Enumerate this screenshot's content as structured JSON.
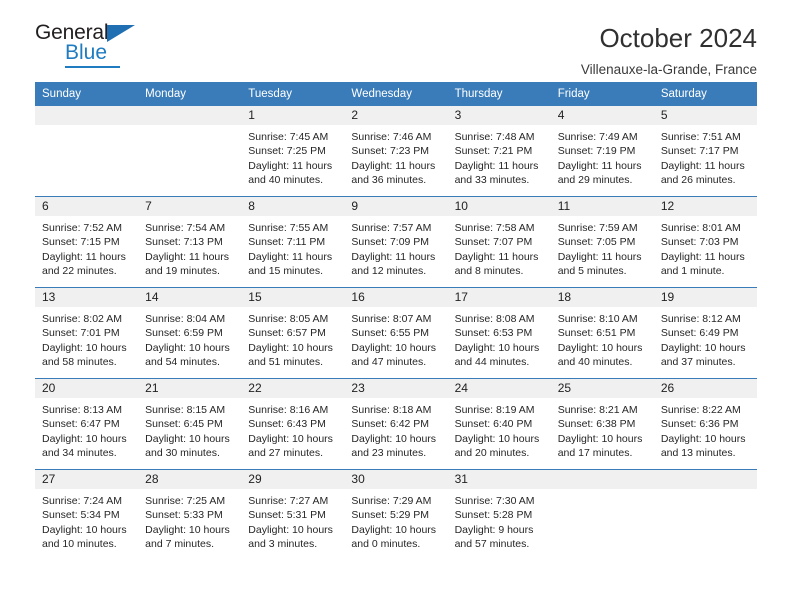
{
  "brand": {
    "name_part1": "General",
    "name_part2": "Blue",
    "triangle_color": "#1f6fb2",
    "blue_color": "#1f7cc1"
  },
  "header": {
    "title": "October 2024",
    "subtitle": "Villenauxe-la-Grande, France"
  },
  "theme": {
    "header_bg": "#3a7cba",
    "daynum_bg": "#f0f0f0",
    "row_divider": "#3a7cba"
  },
  "calendar": {
    "weekday_headers": [
      "Sunday",
      "Monday",
      "Tuesday",
      "Wednesday",
      "Thursday",
      "Friday",
      "Saturday"
    ],
    "labels": {
      "sunrise": "Sunrise:",
      "sunset": "Sunset:",
      "daylight": "Daylight:"
    },
    "weeks": [
      [
        {
          "day": "",
          "empty": true
        },
        {
          "day": "",
          "empty": true
        },
        {
          "day": "1",
          "sunrise": "Sunrise: 7:45 AM",
          "sunset": "Sunset: 7:25 PM",
          "daylight1": "Daylight: 11 hours",
          "daylight2": "and 40 minutes."
        },
        {
          "day": "2",
          "sunrise": "Sunrise: 7:46 AM",
          "sunset": "Sunset: 7:23 PM",
          "daylight1": "Daylight: 11 hours",
          "daylight2": "and 36 minutes."
        },
        {
          "day": "3",
          "sunrise": "Sunrise: 7:48 AM",
          "sunset": "Sunset: 7:21 PM",
          "daylight1": "Daylight: 11 hours",
          "daylight2": "and 33 minutes."
        },
        {
          "day": "4",
          "sunrise": "Sunrise: 7:49 AM",
          "sunset": "Sunset: 7:19 PM",
          "daylight1": "Daylight: 11 hours",
          "daylight2": "and 29 minutes."
        },
        {
          "day": "5",
          "sunrise": "Sunrise: 7:51 AM",
          "sunset": "Sunset: 7:17 PM",
          "daylight1": "Daylight: 11 hours",
          "daylight2": "and 26 minutes."
        }
      ],
      [
        {
          "day": "6",
          "sunrise": "Sunrise: 7:52 AM",
          "sunset": "Sunset: 7:15 PM",
          "daylight1": "Daylight: 11 hours",
          "daylight2": "and 22 minutes."
        },
        {
          "day": "7",
          "sunrise": "Sunrise: 7:54 AM",
          "sunset": "Sunset: 7:13 PM",
          "daylight1": "Daylight: 11 hours",
          "daylight2": "and 19 minutes."
        },
        {
          "day": "8",
          "sunrise": "Sunrise: 7:55 AM",
          "sunset": "Sunset: 7:11 PM",
          "daylight1": "Daylight: 11 hours",
          "daylight2": "and 15 minutes."
        },
        {
          "day": "9",
          "sunrise": "Sunrise: 7:57 AM",
          "sunset": "Sunset: 7:09 PM",
          "daylight1": "Daylight: 11 hours",
          "daylight2": "and 12 minutes."
        },
        {
          "day": "10",
          "sunrise": "Sunrise: 7:58 AM",
          "sunset": "Sunset: 7:07 PM",
          "daylight1": "Daylight: 11 hours",
          "daylight2": "and 8 minutes."
        },
        {
          "day": "11",
          "sunrise": "Sunrise: 7:59 AM",
          "sunset": "Sunset: 7:05 PM",
          "daylight1": "Daylight: 11 hours",
          "daylight2": "and 5 minutes."
        },
        {
          "day": "12",
          "sunrise": "Sunrise: 8:01 AM",
          "sunset": "Sunset: 7:03 PM",
          "daylight1": "Daylight: 11 hours",
          "daylight2": "and 1 minute."
        }
      ],
      [
        {
          "day": "13",
          "sunrise": "Sunrise: 8:02 AM",
          "sunset": "Sunset: 7:01 PM",
          "daylight1": "Daylight: 10 hours",
          "daylight2": "and 58 minutes."
        },
        {
          "day": "14",
          "sunrise": "Sunrise: 8:04 AM",
          "sunset": "Sunset: 6:59 PM",
          "daylight1": "Daylight: 10 hours",
          "daylight2": "and 54 minutes."
        },
        {
          "day": "15",
          "sunrise": "Sunrise: 8:05 AM",
          "sunset": "Sunset: 6:57 PM",
          "daylight1": "Daylight: 10 hours",
          "daylight2": "and 51 minutes."
        },
        {
          "day": "16",
          "sunrise": "Sunrise: 8:07 AM",
          "sunset": "Sunset: 6:55 PM",
          "daylight1": "Daylight: 10 hours",
          "daylight2": "and 47 minutes."
        },
        {
          "day": "17",
          "sunrise": "Sunrise: 8:08 AM",
          "sunset": "Sunset: 6:53 PM",
          "daylight1": "Daylight: 10 hours",
          "daylight2": "and 44 minutes."
        },
        {
          "day": "18",
          "sunrise": "Sunrise: 8:10 AM",
          "sunset": "Sunset: 6:51 PM",
          "daylight1": "Daylight: 10 hours",
          "daylight2": "and 40 minutes."
        },
        {
          "day": "19",
          "sunrise": "Sunrise: 8:12 AM",
          "sunset": "Sunset: 6:49 PM",
          "daylight1": "Daylight: 10 hours",
          "daylight2": "and 37 minutes."
        }
      ],
      [
        {
          "day": "20",
          "sunrise": "Sunrise: 8:13 AM",
          "sunset": "Sunset: 6:47 PM",
          "daylight1": "Daylight: 10 hours",
          "daylight2": "and 34 minutes."
        },
        {
          "day": "21",
          "sunrise": "Sunrise: 8:15 AM",
          "sunset": "Sunset: 6:45 PM",
          "daylight1": "Daylight: 10 hours",
          "daylight2": "and 30 minutes."
        },
        {
          "day": "22",
          "sunrise": "Sunrise: 8:16 AM",
          "sunset": "Sunset: 6:43 PM",
          "daylight1": "Daylight: 10 hours",
          "daylight2": "and 27 minutes."
        },
        {
          "day": "23",
          "sunrise": "Sunrise: 8:18 AM",
          "sunset": "Sunset: 6:42 PM",
          "daylight1": "Daylight: 10 hours",
          "daylight2": "and 23 minutes."
        },
        {
          "day": "24",
          "sunrise": "Sunrise: 8:19 AM",
          "sunset": "Sunset: 6:40 PM",
          "daylight1": "Daylight: 10 hours",
          "daylight2": "and 20 minutes."
        },
        {
          "day": "25",
          "sunrise": "Sunrise: 8:21 AM",
          "sunset": "Sunset: 6:38 PM",
          "daylight1": "Daylight: 10 hours",
          "daylight2": "and 17 minutes."
        },
        {
          "day": "26",
          "sunrise": "Sunrise: 8:22 AM",
          "sunset": "Sunset: 6:36 PM",
          "daylight1": "Daylight: 10 hours",
          "daylight2": "and 13 minutes."
        }
      ],
      [
        {
          "day": "27",
          "sunrise": "Sunrise: 7:24 AM",
          "sunset": "Sunset: 5:34 PM",
          "daylight1": "Daylight: 10 hours",
          "daylight2": "and 10 minutes."
        },
        {
          "day": "28",
          "sunrise": "Sunrise: 7:25 AM",
          "sunset": "Sunset: 5:33 PM",
          "daylight1": "Daylight: 10 hours",
          "daylight2": "and 7 minutes."
        },
        {
          "day": "29",
          "sunrise": "Sunrise: 7:27 AM",
          "sunset": "Sunset: 5:31 PM",
          "daylight1": "Daylight: 10 hours",
          "daylight2": "and 3 minutes."
        },
        {
          "day": "30",
          "sunrise": "Sunrise: 7:29 AM",
          "sunset": "Sunset: 5:29 PM",
          "daylight1": "Daylight: 10 hours",
          "daylight2": "and 0 minutes."
        },
        {
          "day": "31",
          "sunrise": "Sunrise: 7:30 AM",
          "sunset": "Sunset: 5:28 PM",
          "daylight1": "Daylight: 9 hours",
          "daylight2": "and 57 minutes."
        },
        {
          "day": "",
          "empty": true
        },
        {
          "day": "",
          "empty": true
        }
      ]
    ]
  }
}
